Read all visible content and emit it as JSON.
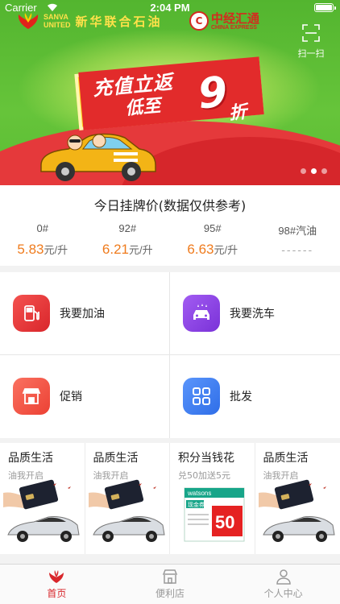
{
  "status_bar": {
    "carrier": "Carrier",
    "time": "2:04 PM"
  },
  "banner": {
    "brand_en": [
      "SANVA",
      "UNITED"
    ],
    "brand_cn": "新华联合石油",
    "partner_cn": "中经汇通",
    "partner_en": "CHINA EXPRESS",
    "partner_badge": "C",
    "scan_label": "扫一扫",
    "promo_line1": "充值立返",
    "promo_line2": "低至",
    "promo_big": "9",
    "promo_tail": "折",
    "slide_count": 3,
    "active_slide": 2
  },
  "prices": {
    "title": "今日挂牌价(数据仅供参考)",
    "items": [
      {
        "name": "0#",
        "value": "5.83",
        "unit": "元/升"
      },
      {
        "name": "92#",
        "value": "6.21",
        "unit": "元/升"
      },
      {
        "name": "95#",
        "value": "6.63",
        "unit": "元/升"
      },
      {
        "name": "98#汽油",
        "placeholder": "------"
      }
    ]
  },
  "services": [
    {
      "label": "我要加油",
      "icon": "fuel-pump-icon",
      "color": "#ea3a3f"
    },
    {
      "label": "我要洗车",
      "icon": "car-wash-icon",
      "color": "#8c45e6"
    },
    {
      "label": "促销",
      "icon": "shop-icon",
      "color": "#f25a4a"
    },
    {
      "label": "批发",
      "icon": "grid-icon",
      "color": "#3d7ef5"
    }
  ],
  "cards": [
    {
      "title": "品质生活",
      "subtitle": "油我开启"
    },
    {
      "title": "品质生活",
      "subtitle": "油我开启"
    },
    {
      "title": "积分当钱花",
      "subtitle": "兑50加送5元",
      "coupon_brand": "watsons",
      "coupon_label": "现金券",
      "coupon_value": "50"
    },
    {
      "title": "品质生活",
      "subtitle": "油我开启"
    }
  ],
  "tabs": [
    {
      "label": "首页",
      "icon": "home-icon",
      "active": true
    },
    {
      "label": "便利店",
      "icon": "store-icon",
      "active": false
    },
    {
      "label": "个人中心",
      "icon": "user-icon",
      "active": false
    }
  ],
  "colors": {
    "accent": "#d8262b",
    "price": "#ef7b1d",
    "banner_green": "#5bbd34"
  }
}
